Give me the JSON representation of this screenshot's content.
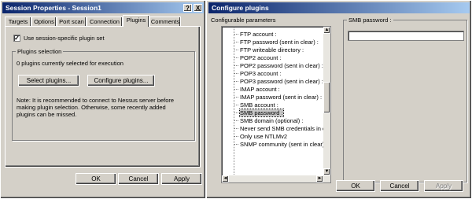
{
  "left_window": {
    "title": "Session Properties - Session1",
    "title_buttons": [
      "?",
      "X"
    ],
    "tabs": [
      "Targets",
      "Options",
      "Port scan",
      "Connection",
      "Plugins",
      "Comments"
    ],
    "active_tab": "Plugins",
    "use_session_specific": {
      "label": "Use session-specific plugin set",
      "checked": true
    },
    "group_title": "Plugins selection",
    "status_text": "0 plugins currently selected for execution",
    "select_plugins_button": "Select plugins...",
    "configure_plugins_button": "Configure plugins...",
    "note_lines": [
      "Note: It is recommended to connect to Nessus server before",
      "making plugin selection. Otherwise, some recently added",
      "plugins can be missed."
    ],
    "ok_button": "OK",
    "cancel_button": "Cancel",
    "apply_button": "Apply"
  },
  "right_window": {
    "title": "Configure plugins",
    "params_label": "Configurable parameters",
    "parameters": [
      "FTP account :",
      "FTP password (sent in clear) :",
      "FTP writeable directory :",
      "POP2 account :",
      "POP2 password (sent in clear) :",
      "POP3 account :",
      "POP3 password (sent in clear) :",
      "IMAP account :",
      "IMAP password (sent in clear) :",
      "SMB account :",
      "SMB password :",
      "SMB domain (optional) :",
      "Never send SMB credentials in c",
      "Only use NTLMv2",
      "SNMP community (sent in clear) :"
    ],
    "selected_parameter": "SMB password :",
    "value_group_label": "SMB password :",
    "value_field": "",
    "ok_button": "OK",
    "cancel_button": "Cancel",
    "apply_button": "Apply"
  }
}
